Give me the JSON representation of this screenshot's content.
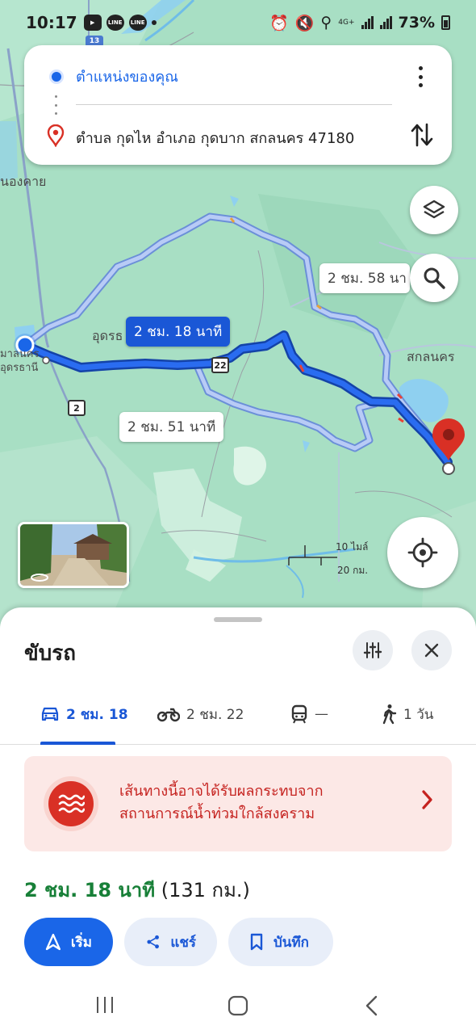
{
  "status_bar": {
    "time": "10:17",
    "app_chip": "LINE",
    "network": "4G+",
    "battery": "73%"
  },
  "directions": {
    "origin": "ตำแหน่งของคุณ",
    "destination": "ตำบล กุดไห อำเภอ กุดบาก สกลนคร 47180"
  },
  "map": {
    "labels": {
      "nong_khai": "นองคาย",
      "udon": "อุดรธ",
      "udon_city_1": "มาลนคร",
      "udon_city_2": "อุดรธานี",
      "sakon": "สกลนคร"
    },
    "highway_22": "22",
    "highway_2": "2",
    "highway_13": "13",
    "route_labels": {
      "primary": "2 ชม. 18 นาที",
      "alt_north": "2 ชม. 58 นา",
      "alt_south": "2 ชม. 51 นาที"
    },
    "scale": {
      "miles": "10 ไมล์",
      "km": "20 กม."
    },
    "colors": {
      "primary_route": "#1a57d6",
      "alt_route": "#b3c6f5",
      "destination_pin": "#d93025",
      "water": "#8fd0f0",
      "land": "#a8dfc4"
    }
  },
  "sheet": {
    "title": "ขับรถ",
    "modes": [
      {
        "icon": "car-icon",
        "label": "2 ชม. 18",
        "active": true
      },
      {
        "icon": "motorcycle-icon",
        "label": "2 ชม. 22",
        "active": false
      },
      {
        "icon": "train-icon",
        "label": "—",
        "active": false
      },
      {
        "icon": "walk-icon",
        "label": "1 วัน",
        "active": false
      }
    ],
    "alert": {
      "icon": "flood-icon",
      "line1": "เส้นทางนี้อาจได้รับผลกระทบจาก",
      "line2": "สถานการณ์น้ำท่วมใกล้สงคราม"
    },
    "summary": {
      "duration": "2 ชม. 18 นาที",
      "distance": "(131 กม.)"
    },
    "actions": {
      "start": "เริ่ม",
      "share": "แชร์",
      "save": "บันทึก"
    }
  }
}
